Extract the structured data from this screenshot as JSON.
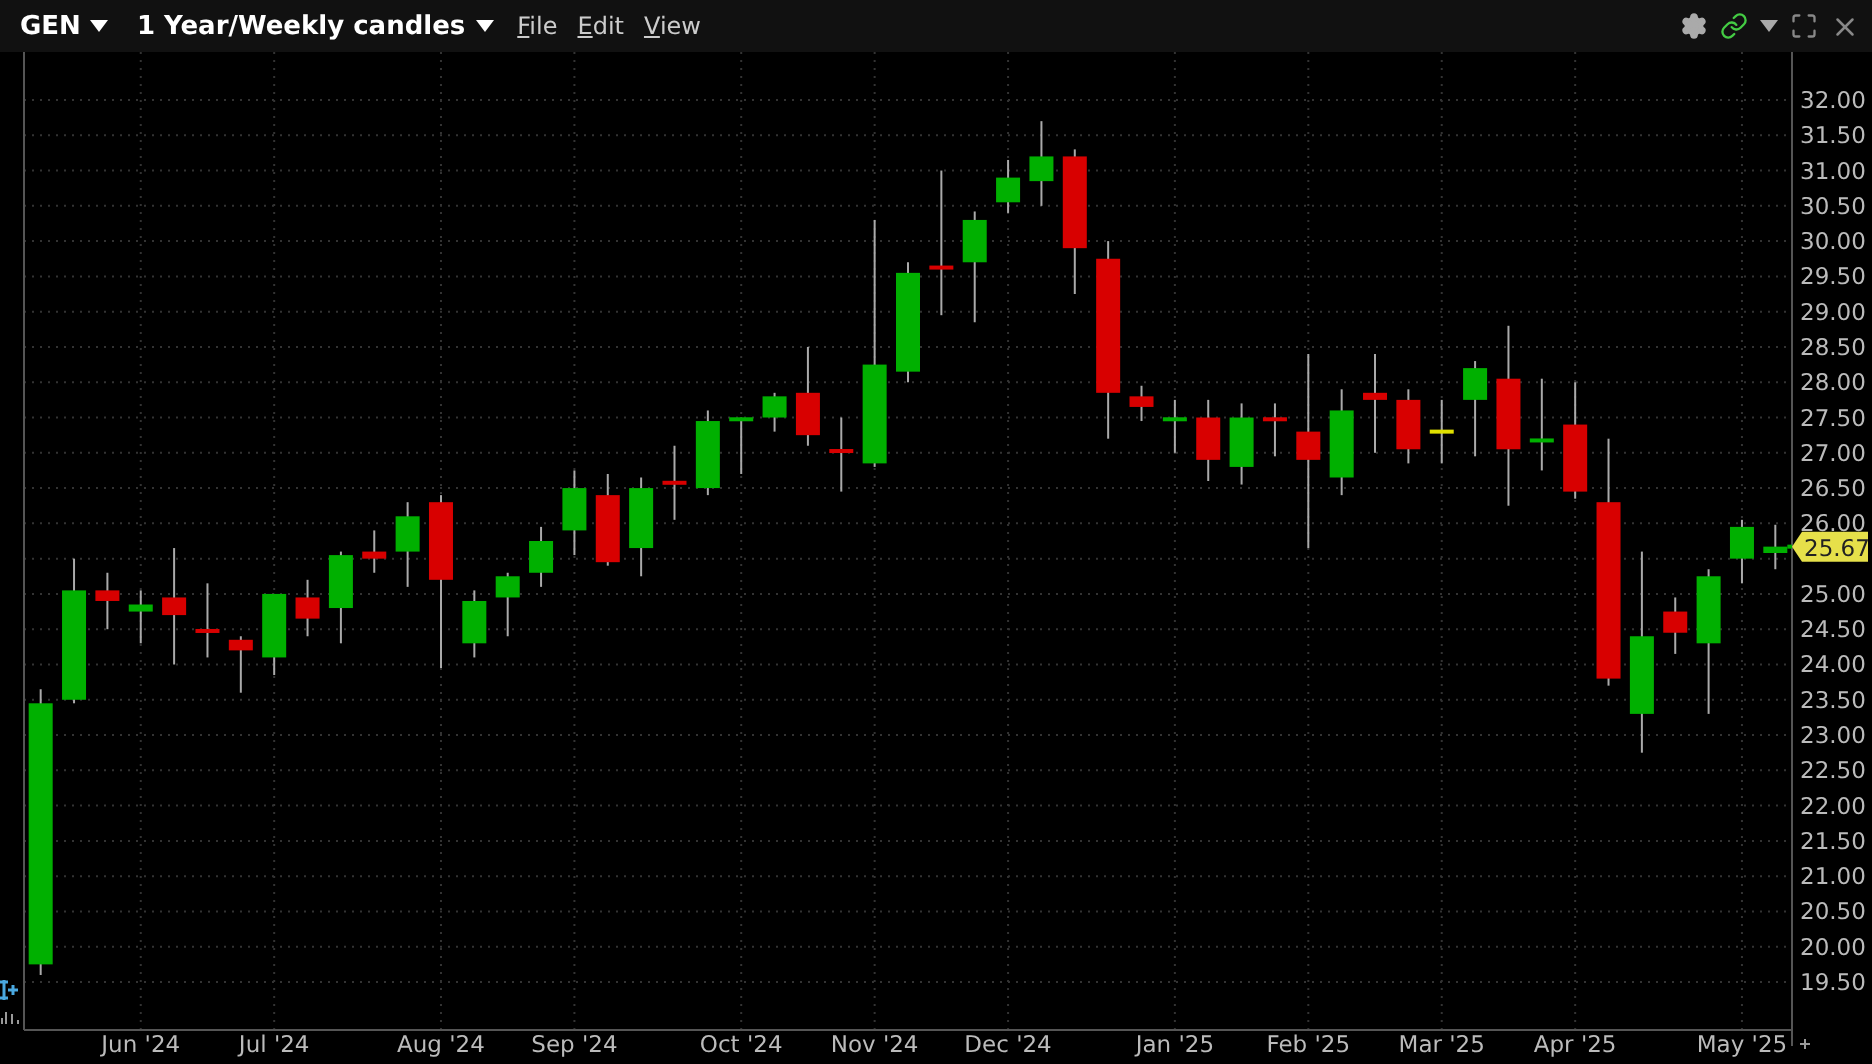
{
  "toolbar": {
    "symbol": "GEN",
    "period": "1 Year/Weekly candles",
    "menus": [
      "File",
      "Edit",
      "View"
    ]
  },
  "chart": {
    "last_price": "25.67",
    "chart_data": {
      "type": "candlestick",
      "grid": true,
      "categories": [
        null,
        null,
        null,
        "Jun '24",
        null,
        null,
        null,
        "Jul '24",
        null,
        null,
        null,
        null,
        "Aug '24",
        null,
        null,
        null,
        "Sep '24",
        null,
        null,
        null,
        null,
        "Oct '24",
        null,
        null,
        null,
        "Nov '24",
        null,
        null,
        null,
        "Dec '24",
        null,
        null,
        null,
        null,
        "Jan '25",
        null,
        null,
        null,
        "Feb '25",
        null,
        null,
        null,
        "Mar '25",
        null,
        null,
        null,
        "Apr '25",
        null,
        null,
        null,
        null,
        "May '25",
        null
      ],
      "ylim": [
        18.82,
        32.68
      ],
      "yticks": [
        {
          "value": 32,
          "label": "32.00"
        },
        {
          "value": 31.5,
          "label": "31.50"
        },
        {
          "value": 31,
          "label": "31.00"
        },
        {
          "value": 30.5,
          "label": "30.50"
        },
        {
          "value": 30,
          "label": "30.00"
        },
        {
          "value": 29.5,
          "label": "29.50"
        },
        {
          "value": 29,
          "label": "29.00"
        },
        {
          "value": 28.5,
          "label": "28.50"
        },
        {
          "value": 28,
          "label": "28.00"
        },
        {
          "value": 27.5,
          "label": "27.50"
        },
        {
          "value": 27,
          "label": "27.00"
        },
        {
          "value": 26.5,
          "label": "26.50"
        },
        {
          "value": 26,
          "label": "26.00"
        },
        {
          "value": 25,
          "label": "25.00"
        },
        {
          "value": 24.5,
          "label": "24.50"
        },
        {
          "value": 24,
          "label": "24.00"
        },
        {
          "value": 23.5,
          "label": "23.50"
        },
        {
          "value": 23,
          "label": "23.00"
        },
        {
          "value": 22.5,
          "label": "22.50"
        },
        {
          "value": 22,
          "label": "22.00"
        },
        {
          "value": 21.5,
          "label": "21.50"
        },
        {
          "value": 21,
          "label": "21.00"
        },
        {
          "value": 20.5,
          "label": "20.50"
        },
        {
          "value": 20,
          "label": "20.00"
        },
        {
          "value": 19.5,
          "label": "19.50"
        }
      ],
      "ohlc": [
        [
          19.75,
          23.65,
          19.6,
          23.45
        ],
        [
          23.5,
          25.5,
          23.45,
          25.05
        ],
        [
          25.05,
          25.3,
          24.5,
          24.9
        ],
        [
          24.75,
          25.05,
          24.3,
          24.85
        ],
        [
          24.95,
          25.65,
          24,
          24.7
        ],
        [
          24.5,
          25.15,
          24.1,
          24.45
        ],
        [
          24.35,
          24.4,
          23.6,
          24.2
        ],
        [
          24.1,
          25,
          23.85,
          25
        ],
        [
          24.95,
          25.2,
          24.4,
          24.65
        ],
        [
          24.8,
          25.6,
          24.3,
          25.55
        ],
        [
          25.6,
          25.9,
          25.3,
          25.5
        ],
        [
          25.6,
          26.3,
          25.1,
          26.1
        ],
        [
          26.3,
          26.4,
          23.95,
          25.2
        ],
        [
          24.3,
          25.05,
          24.1,
          24.9
        ],
        [
          24.95,
          25.3,
          24.4,
          25.25
        ],
        [
          25.3,
          25.95,
          25.1,
          25.75
        ],
        [
          25.9,
          26.75,
          25.55,
          26.5
        ],
        [
          26.4,
          26.7,
          25.4,
          25.45
        ],
        [
          25.65,
          26.65,
          25.25,
          26.5
        ],
        [
          26.6,
          27.1,
          26.05,
          26.55
        ],
        [
          26.5,
          27.6,
          26.4,
          27.45
        ],
        [
          27.45,
          27.5,
          26.7,
          27.5
        ],
        [
          27.5,
          27.85,
          27.3,
          27.8
        ],
        [
          27.85,
          28.5,
          27.1,
          27.25
        ],
        [
          27.05,
          27.5,
          26.45,
          27
        ],
        [
          26.85,
          30.3,
          26.8,
          28.25
        ],
        [
          28.15,
          29.7,
          28,
          29.55
        ],
        [
          29.65,
          31,
          28.95,
          29.6
        ],
        [
          29.7,
          30.42,
          28.85,
          30.3
        ],
        [
          30.55,
          31.15,
          30.4,
          30.9
        ],
        [
          30.85,
          31.7,
          30.5,
          31.2
        ],
        [
          31.2,
          31.3,
          29.25,
          29.9
        ],
        [
          29.75,
          30,
          27.2,
          27.85
        ],
        [
          27.8,
          27.95,
          27.45,
          27.65
        ],
        [
          27.45,
          27.75,
          27,
          27.5
        ],
        [
          27.5,
          27.75,
          26.6,
          26.9
        ],
        [
          26.8,
          27.7,
          26.55,
          27.5
        ],
        [
          27.5,
          27.7,
          26.95,
          27.45
        ],
        [
          27.3,
          28.4,
          25.65,
          26.9
        ],
        [
          26.65,
          27.9,
          26.4,
          27.6
        ],
        [
          27.85,
          28.4,
          27,
          27.75
        ],
        [
          27.75,
          27.9,
          26.85,
          27.05
        ],
        [
          27.3,
          27.75,
          26.85,
          27.3
        ],
        [
          27.75,
          28.3,
          26.95,
          28.2
        ],
        [
          28.05,
          28.8,
          26.25,
          27.05
        ],
        [
          27.15,
          28.05,
          26.75,
          27.2
        ],
        [
          27.4,
          28,
          26.35,
          26.45
        ],
        [
          26.3,
          27.2,
          23.7,
          23.8
        ],
        [
          23.3,
          25.6,
          22.75,
          24.4
        ],
        [
          24.75,
          24.95,
          24.15,
          24.45
        ],
        [
          24.3,
          25.35,
          23.3,
          25.25
        ],
        [
          25.5,
          26.05,
          25.15,
          25.95
        ],
        [
          25.58,
          25.98,
          25.35,
          25.67
        ]
      ]
    }
  }
}
